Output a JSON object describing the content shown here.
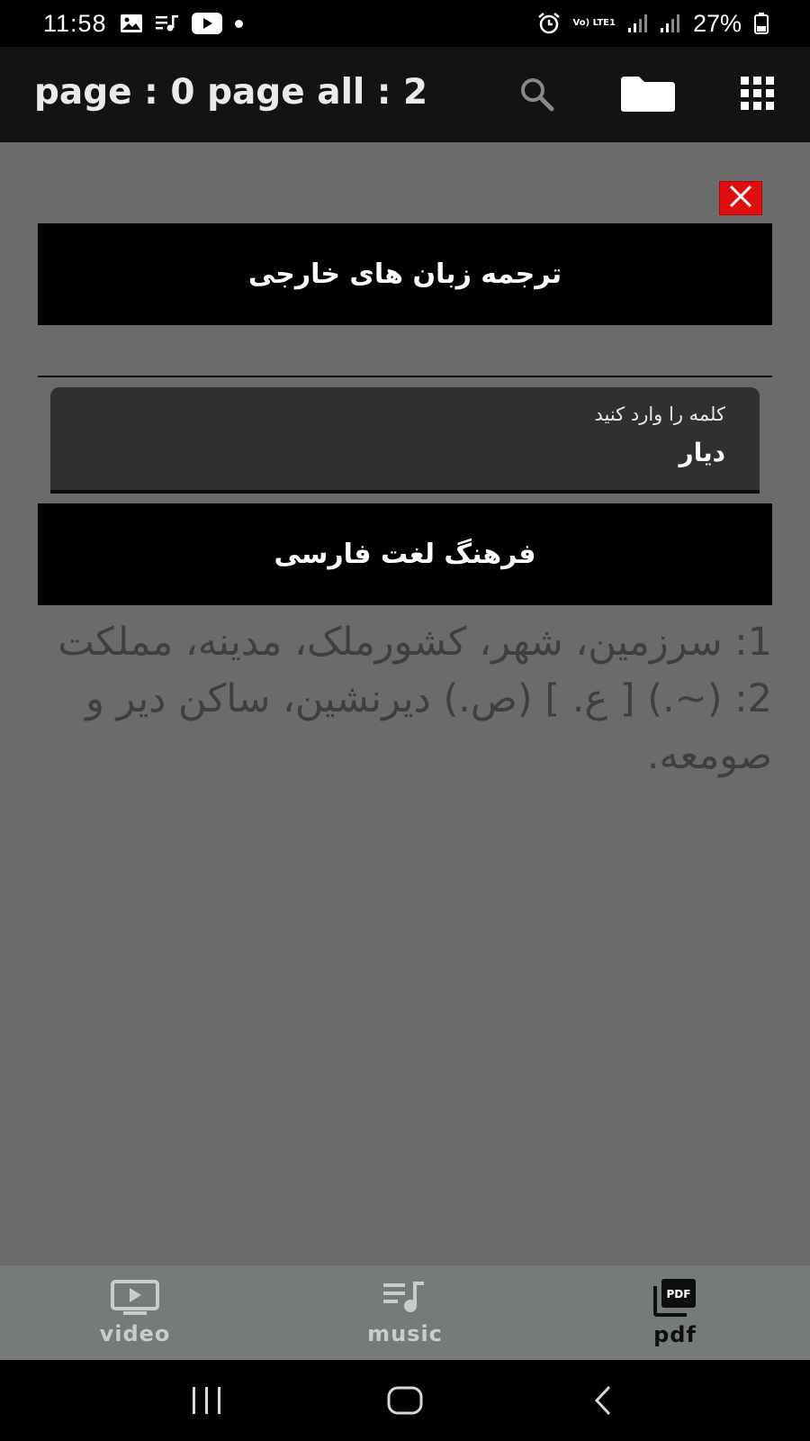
{
  "status_bar": {
    "time": "11:58",
    "battery": "27%",
    "network_label": "Vo) LTE1",
    "icons": [
      "gallery-icon",
      "music-queue-icon",
      "youtube-icon",
      "dot-icon",
      "alarm-icon",
      "signal-icon",
      "signal-icon",
      "battery-icon"
    ]
  },
  "app_bar": {
    "page_info": "page : 0 page all : 2",
    "icons": [
      "search-icon",
      "folder-icon",
      "grid-menu-icon"
    ]
  },
  "dialog": {
    "translate_button": "ترجمه زبان های خارجی",
    "input_label": "کلمه را وارد کنید",
    "input_value": "دیار",
    "dictionary_button": "فرهنگ لغت فارسی",
    "definition": "1: سرزمین، شهر، کشورملک، مدینه، مملکت 2: (~.) [ ع. ] (ص.) دیرنشین، ساکن دیر و صومعه."
  },
  "bottom_nav": {
    "items": [
      {
        "label": "video",
        "icon": "video-icon",
        "active": false
      },
      {
        "label": "music",
        "icon": "music-icon",
        "active": false
      },
      {
        "label": "pdf",
        "icon": "pdf-icon",
        "active": true
      }
    ]
  },
  "colors": {
    "background": "#6a6b6a",
    "app_bar": "#131313",
    "close_red": "#e00f0f",
    "bottom_nav": "#767a7b"
  }
}
